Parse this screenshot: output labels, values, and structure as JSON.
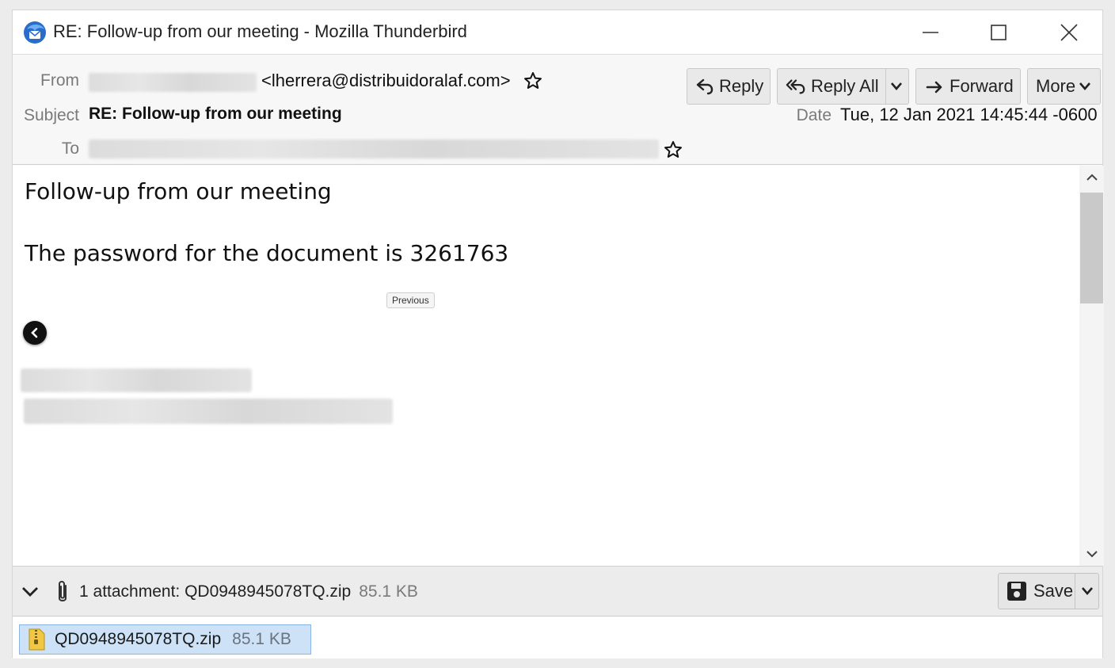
{
  "window": {
    "title": "RE: Follow-up from our meeting - Mozilla Thunderbird",
    "controls": [
      "minimize",
      "maximize",
      "close"
    ]
  },
  "header": {
    "from_label": "From",
    "from_email": "<lherrera@distribuidoralaf.com>",
    "subject_label": "Subject",
    "subject": "RE: Follow-up from our meeting",
    "to_label": "To",
    "date_label": "Date",
    "date": "Tue, 12 Jan 2021 14:45:44 -0600",
    "buttons": {
      "reply": "Reply",
      "reply_all": "Reply All",
      "forward": "Forward",
      "more": "More"
    }
  },
  "body": {
    "line1": "Follow-up from our meeting",
    "line2": "The password for the document is 3261763",
    "previous_tooltip": "Previous"
  },
  "attachments": {
    "summary": "1 attachment: QD0948945078TQ.zip",
    "summary_size": "85.1 KB",
    "save_label": "Save",
    "items": [
      {
        "name": "QD0948945078TQ.zip",
        "size": "85.1 KB"
      }
    ]
  },
  "icons": {
    "app": "thunderbird-icon",
    "reply": "reply-arrow-icon",
    "reply_all": "reply-all-arrow-icon",
    "forward": "forward-arrow-icon",
    "star": "star-outline-icon",
    "attachment": "paperclip-icon",
    "save": "save-disk-icon",
    "zip": "zip-file-icon"
  },
  "colors": {
    "selected_attachment_bg": "#cde1f7",
    "selected_attachment_border": "#8ab4e3",
    "thunderbird_blue": "#2a6cc9"
  }
}
